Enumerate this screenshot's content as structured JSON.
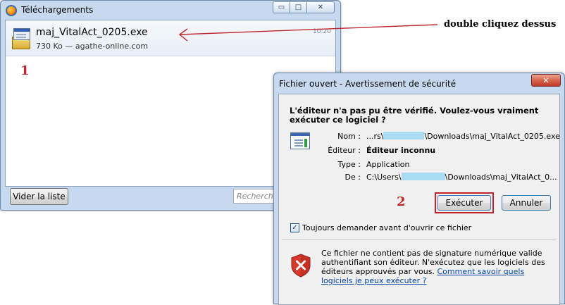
{
  "downloads_window": {
    "title": "Téléchargements",
    "minimize_glyph": "▭",
    "maximize_glyph": "□",
    "close_glyph": "✕",
    "item": {
      "filename": "maj_VitalAct_0205.exe",
      "meta": "730 Ko — agathe-online.com",
      "time": "10:20"
    },
    "step_number": "1",
    "clear_list_label": "Vider la liste",
    "search_placeholder": "Rechercher"
  },
  "annotation": {
    "text": "double cliquez dessus",
    "arrow_color": "#c0272d"
  },
  "security_dialog": {
    "title": "Fichier ouvert - Avertissement de sécurité",
    "close_glyph": "✕",
    "question": "L'éditeur n'a pas pu être vérifié. Voulez-vous vraiment exécuter ce logiciel ?",
    "fields": {
      "name_label": "Nom :",
      "name_prefix": "...rs\\",
      "name_suffix": "\\Downloads\\maj_VitalAct_0205.exe",
      "publisher_label": "Éditeur :",
      "publisher_value": "Éditeur inconnu",
      "type_label": "Type :",
      "type_value": "Application",
      "from_label": "De :",
      "from_prefix": "C:\\Users\\",
      "from_suffix": "\\Downloads\\maj_VitalAct_0..."
    },
    "step_number": "2",
    "run_label": "Exécuter",
    "cancel_label": "Annuler",
    "checkbox_label": "Toujours demander avant d'ouvrir ce fichier",
    "checkbox_checked": true,
    "checkbox_glyph": "✓",
    "warning_text": "Ce fichier ne contient pas de signature numérique valide authentifiant son éditeur. N'exécutez que les logiciels des éditeurs approuvés par vous.",
    "warning_link": "Comment savoir quels logiciels je peux exécuter ?"
  }
}
